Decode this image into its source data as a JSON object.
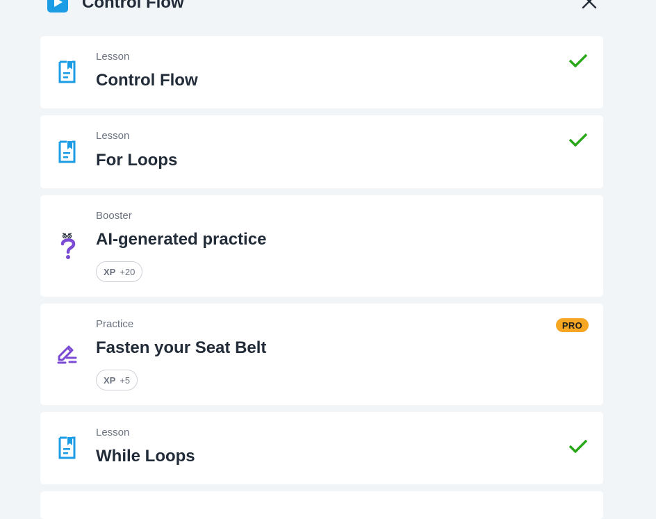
{
  "header": {
    "title": "Control Flow"
  },
  "colors": {
    "background": "#f2f5f8",
    "lesson_icon": "#1b9ce5",
    "booster_icon": "#7b4bd3",
    "practice_icon": "#7b4bd3",
    "check": "#2aa81a",
    "pro_badge": "#f5a623",
    "text_primary": "#222b38",
    "text_secondary": "#6b7380"
  },
  "items": [
    {
      "type": "Lesson",
      "title": "Control Flow",
      "icon": "lesson-document-icon",
      "completed": true
    },
    {
      "type": "Lesson",
      "title": "For Loops",
      "icon": "lesson-document-icon",
      "completed": true
    },
    {
      "type": "Booster",
      "title": "AI-generated practice",
      "icon": "question-mark-icon",
      "xp_label": "XP",
      "xp_value": "+20"
    },
    {
      "type": "Practice",
      "title": "Fasten your Seat Belt",
      "icon": "pencil-icon",
      "badge": "PRO",
      "xp_label": "XP",
      "xp_value": "+5"
    },
    {
      "type": "Lesson",
      "title": "While Loops",
      "icon": "lesson-document-icon",
      "completed": true
    }
  ]
}
